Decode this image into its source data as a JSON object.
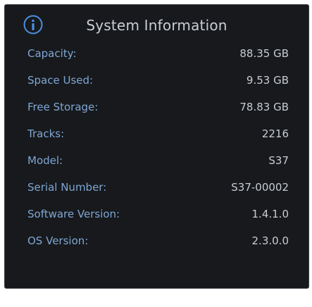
{
  "dialog": {
    "title": "System Information",
    "icon": "info-icon",
    "accent_color": "#4a90e2",
    "label_color": "#7fa6d4",
    "value_color": "#c8ccd2"
  },
  "rows": [
    {
      "label": "Capacity:",
      "value": "88.35 GB"
    },
    {
      "label": "Space Used:",
      "value": "9.53 GB"
    },
    {
      "label": "Free Storage:",
      "value": "78.83 GB"
    },
    {
      "label": "Tracks:",
      "value": "2216"
    },
    {
      "label": "Model:",
      "value": "S37"
    },
    {
      "label": "Serial Number:",
      "value": "S37-00002"
    },
    {
      "label": "Software Version:",
      "value": "1.4.1.0"
    },
    {
      "label": "OS Version:",
      "value": "2.3.0.0"
    }
  ]
}
